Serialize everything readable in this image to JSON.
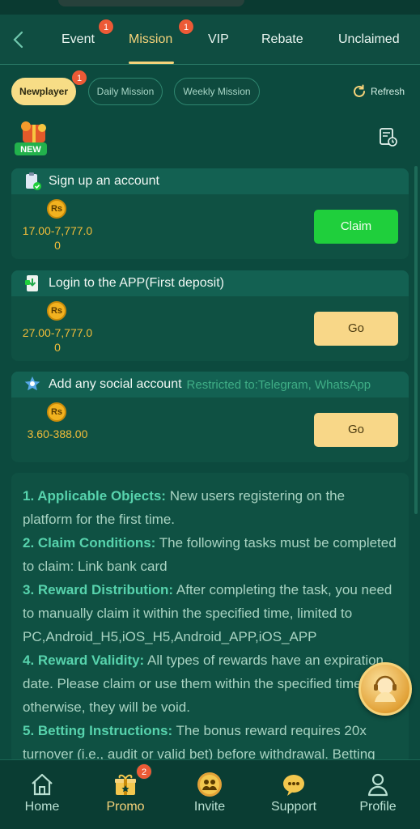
{
  "header": {
    "tabs": [
      {
        "label": "Event",
        "badge": "1"
      },
      {
        "label": "Mission",
        "badge": "1",
        "active": true
      },
      {
        "label": "VIP"
      },
      {
        "label": "Rebate"
      },
      {
        "label": "Unclaimed"
      }
    ]
  },
  "filters": {
    "pills": [
      {
        "label": "Newplayer",
        "badge": "1",
        "active": true
      },
      {
        "label": "Daily Mission"
      },
      {
        "label": "Weekly Mission"
      }
    ],
    "refresh_label": "Refresh"
  },
  "new_label": "NEW",
  "tasks": [
    {
      "title": "Sign up an account",
      "currency": "Rs",
      "amount": "17.00-7,777.00",
      "button": "Claim",
      "button_type": "claim"
    },
    {
      "title": "Login to the APP(First deposit)",
      "currency": "Rs",
      "amount": "27.00-7,777.00",
      "button": "Go",
      "button_type": "go"
    },
    {
      "title": "Add any social account",
      "restriction": "Restricted to:Telegram, WhatsApp",
      "currency": "Rs",
      "amount": "3.60-388.00",
      "button": "Go",
      "button_type": "go"
    }
  ],
  "rules": [
    {
      "heading": "1. Applicable Objects:",
      "text": " New users registering on the platform for the first time."
    },
    {
      "heading": "2. Claim Conditions:",
      "text": " The following tasks must be completed to claim: Link bank card"
    },
    {
      "heading": "3. Reward Distribution:",
      "text": " After completing the task, you need to manually claim it within the specified time, limited to PC,Android_H5,iOS_H5,Android_APP,iOS_APP"
    },
    {
      "heading": "4. Reward Validity:",
      "text": " All types of rewards have an expiration date. Please claim or use them within the specified time; otherwise, they will be void."
    },
    {
      "heading": "5. Betting Instructions:",
      "text": " The bonus reward requires 20x turnover (i.e., audit or valid bet) before withdrawal. Betting"
    }
  ],
  "bottom_nav": {
    "items": [
      {
        "label": "Home"
      },
      {
        "label": "Promo",
        "badge": "2",
        "active": true
      },
      {
        "label": "Invite"
      },
      {
        "label": "Support"
      },
      {
        "label": "Profile"
      }
    ]
  },
  "colors": {
    "background": "#0c4a3e",
    "accent": "#f6d37a",
    "claim": "#1fcf3c",
    "go": "#f8d788",
    "amount": "#f2bd3a",
    "badge": "#ec5a36"
  }
}
